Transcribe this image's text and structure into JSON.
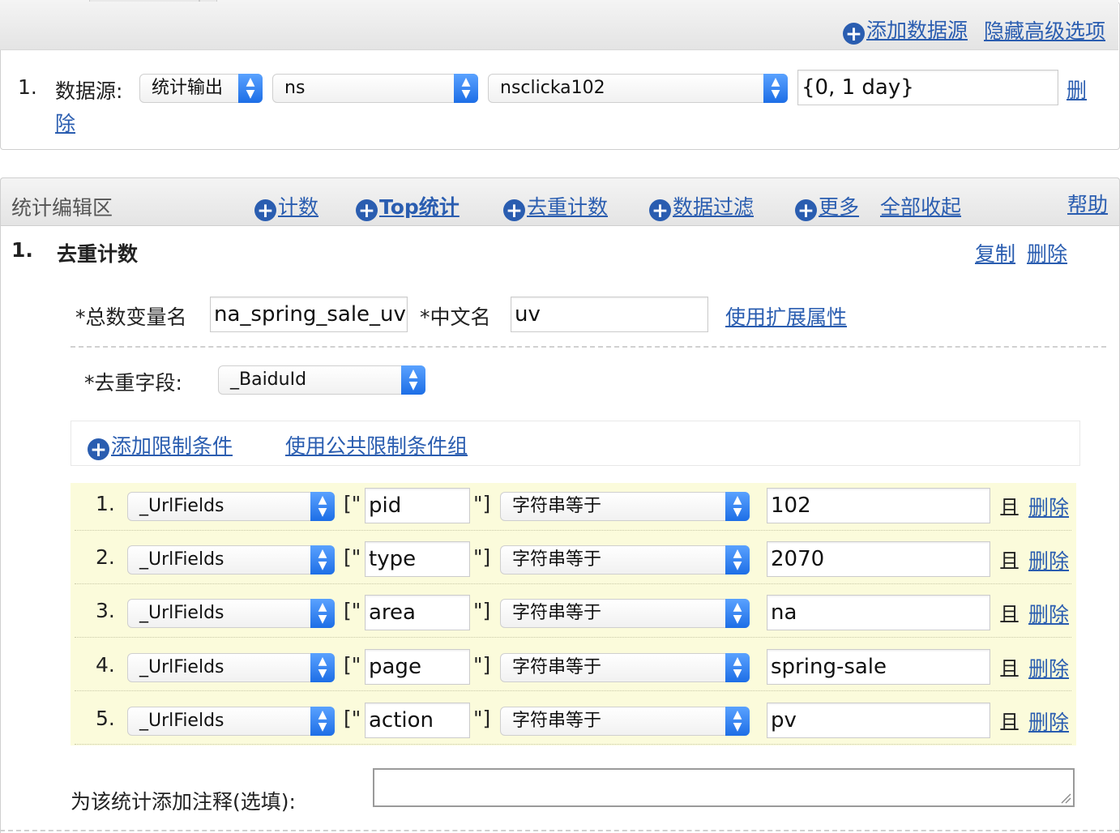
{
  "top_links": {
    "add_datasource": "添加数据源",
    "hide_advanced": "隐藏高级选项"
  },
  "datasource": {
    "index": "1.",
    "label": "数据源:",
    "type_select": "统计输出",
    "namespace_select": "ns",
    "name_select": "nsclicka102",
    "range_input": "{0, 1 day}",
    "delete_part1": "删",
    "delete_part2": "除"
  },
  "edit_area": {
    "title": "统计编辑区",
    "toolbar": {
      "count": "计数",
      "top": "Top统计",
      "distinct_count": "去重计数",
      "filter": "数据过滤",
      "more": "更多",
      "collapse_all": "全部收起"
    },
    "help": "帮助"
  },
  "stat": {
    "index": "1.",
    "title": "去重计数",
    "copy": "复制",
    "delete": "删除",
    "total_var_label": "*总数变量名",
    "total_var_value": "na_spring_sale_uv",
    "cn_name_label": "*中文名",
    "cn_name_value": "uv",
    "use_ext_attr": "使用扩展属性",
    "distinct_field_label": "*去重字段:",
    "distinct_field_value": "_BaiduId",
    "add_condition": "添加限制条件",
    "use_public_conditions": "使用公共限制条件组",
    "conditions": [
      {
        "index": "1.",
        "field": "_UrlFields",
        "open": "[\"",
        "key": "pid",
        "close": "\"]",
        "op": "字符串等于",
        "value": "102",
        "and": "且",
        "delete": "删除"
      },
      {
        "index": "2.",
        "field": "_UrlFields",
        "open": "[\"",
        "key": "type",
        "close": "\"]",
        "op": "字符串等于",
        "value": "2070",
        "and": "且",
        "delete": "删除"
      },
      {
        "index": "3.",
        "field": "_UrlFields",
        "open": "[\"",
        "key": "area",
        "close": "\"]",
        "op": "字符串等于",
        "value": "na",
        "and": "且",
        "delete": "删除"
      },
      {
        "index": "4.",
        "field": "_UrlFields",
        "open": "[\"",
        "key": "page",
        "close": "\"]",
        "op": "字符串等于",
        "value": "spring-sale",
        "and": "且",
        "delete": "删除"
      },
      {
        "index": "5.",
        "field": "_UrlFields",
        "open": "[\"",
        "key": "action",
        "close": "\"]",
        "op": "字符串等于",
        "value": "pv",
        "and": "且",
        "delete": "删除"
      }
    ],
    "comment_label": "为该统计添加注释(选填):",
    "comment_value": ""
  },
  "colors": {
    "link": "#2a5db0",
    "header_bg": "#e9e9e9",
    "condition_bg": "#fbfbdb",
    "select_arrow": "#1d6ee6"
  }
}
